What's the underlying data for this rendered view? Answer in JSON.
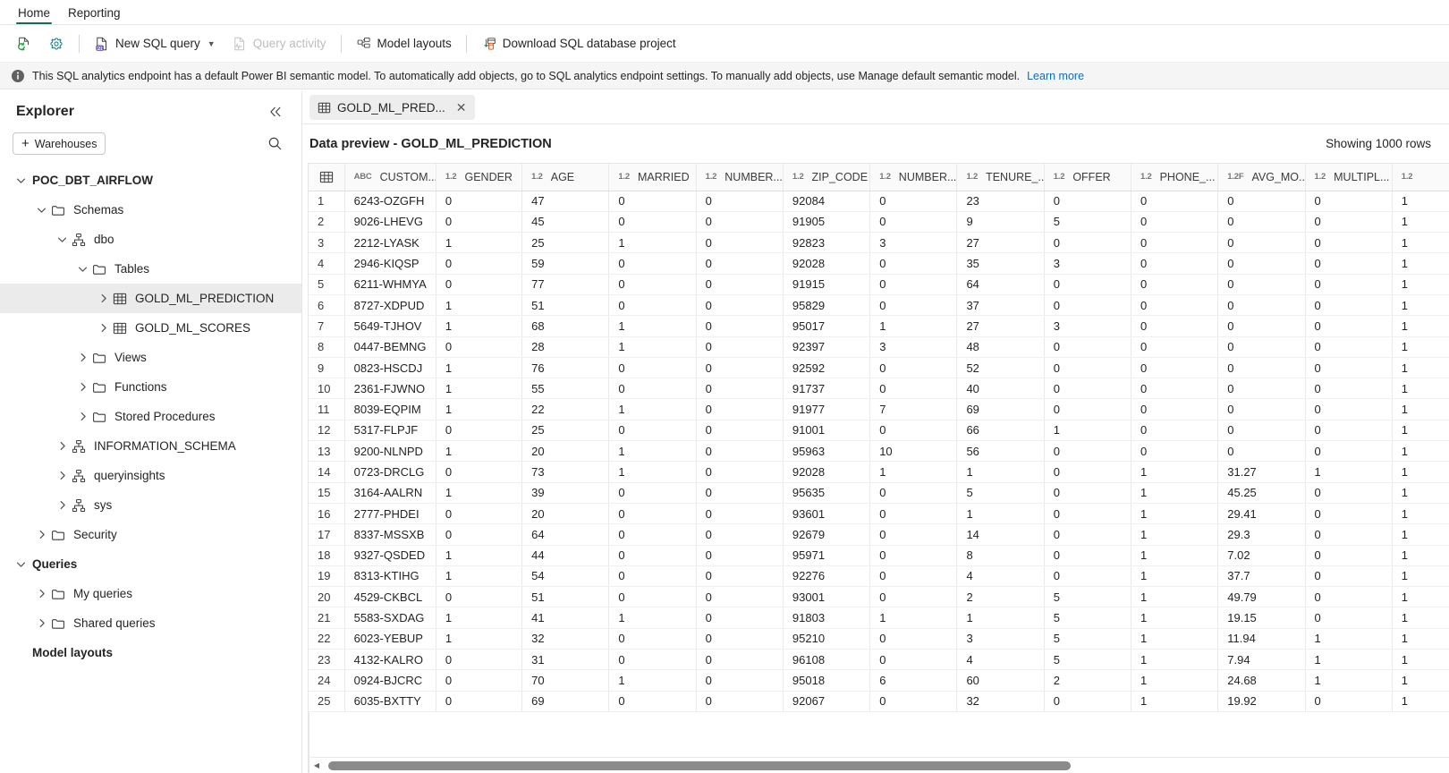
{
  "ribbon": {
    "tabs": [
      {
        "label": "Home",
        "active": true
      },
      {
        "label": "Reporting",
        "active": false
      }
    ]
  },
  "commandbar": {
    "refresh_tooltip": "Refresh",
    "settings_tooltip": "Settings",
    "new_sql_query": "New SQL query",
    "query_activity": "Query activity",
    "model_layouts": "Model layouts",
    "download_project": "Download SQL database project"
  },
  "infobar": {
    "message": "This SQL analytics endpoint has a default Power BI semantic model. To automatically add objects, go to SQL analytics endpoint settings. To manually add objects, use Manage default semantic model.",
    "link": "Learn more",
    "link_color": "#0f6cbd"
  },
  "explorer": {
    "title": "Explorer",
    "collapse_label": "«",
    "warehouses_button": "Warehouses",
    "add_glyph": "+",
    "tree": [
      {
        "label": "POC_DBT_AIRFLOW",
        "icon": "none",
        "expanded": true,
        "indent": 0,
        "bold": true,
        "selected": false
      },
      {
        "label": "Schemas",
        "icon": "folder",
        "expanded": true,
        "indent": 1,
        "bold": false,
        "selected": false
      },
      {
        "label": "dbo",
        "icon": "schema",
        "expanded": true,
        "indent": 2,
        "bold": false,
        "selected": false
      },
      {
        "label": "Tables",
        "icon": "folder",
        "expanded": true,
        "indent": 3,
        "bold": false,
        "selected": false
      },
      {
        "label": "GOLD_ML_PREDICTION",
        "icon": "table",
        "expanded": false,
        "indent": 4,
        "bold": false,
        "selected": true
      },
      {
        "label": "GOLD_ML_SCORES",
        "icon": "table",
        "expanded": false,
        "indent": 4,
        "bold": false,
        "selected": false
      },
      {
        "label": "Views",
        "icon": "folder",
        "expanded": false,
        "indent": 3,
        "bold": false,
        "selected": false
      },
      {
        "label": "Functions",
        "icon": "folder",
        "expanded": false,
        "indent": 3,
        "bold": false,
        "selected": false
      },
      {
        "label": "Stored Procedures",
        "icon": "folder",
        "expanded": false,
        "indent": 3,
        "bold": false,
        "selected": false
      },
      {
        "label": "INFORMATION_SCHEMA",
        "icon": "schema",
        "expanded": false,
        "indent": 2,
        "bold": false,
        "selected": false
      },
      {
        "label": "queryinsights",
        "icon": "schema",
        "expanded": false,
        "indent": 2,
        "bold": false,
        "selected": false
      },
      {
        "label": "sys",
        "icon": "schema",
        "expanded": false,
        "indent": 2,
        "bold": false,
        "selected": false
      },
      {
        "label": "Security",
        "icon": "folder",
        "expanded": false,
        "indent": 1,
        "bold": false,
        "selected": false
      },
      {
        "label": "Queries",
        "icon": "none",
        "expanded": true,
        "indent": 0,
        "bold": true,
        "selected": false
      },
      {
        "label": "My queries",
        "icon": "folder",
        "expanded": false,
        "indent": 1,
        "bold": false,
        "selected": false
      },
      {
        "label": "Shared queries",
        "icon": "folder",
        "expanded": false,
        "indent": 1,
        "bold": false,
        "selected": false
      },
      {
        "label": "Model layouts",
        "icon": "none",
        "expanded": null,
        "indent": 0,
        "bold": true,
        "selected": false
      }
    ]
  },
  "document_tab": {
    "label": "GOLD_ML_PRED...",
    "icon": "table-icon",
    "close_glyph": "✕"
  },
  "preview": {
    "title": "Data preview - GOLD_ML_PREDICTION",
    "rows_label": "Showing 1000 rows"
  },
  "grid": {
    "rownum_header_icon": "table-icon",
    "columns": [
      {
        "name": "CUSTOM...",
        "type": "ABC"
      },
      {
        "name": "GENDER",
        "type": "1.2"
      },
      {
        "name": "AGE",
        "type": "1.2"
      },
      {
        "name": "MARRIED",
        "type": "1.2"
      },
      {
        "name": "NUMBER...",
        "type": "1.2"
      },
      {
        "name": "ZIP_CODE",
        "type": "1.2"
      },
      {
        "name": "NUMBER...",
        "type": "1.2"
      },
      {
        "name": "TENURE_...",
        "type": "1.2"
      },
      {
        "name": "OFFER",
        "type": "1.2"
      },
      {
        "name": "PHONE_...",
        "type": "1.2"
      },
      {
        "name": "AVG_MO...",
        "type": "1.2F"
      },
      {
        "name": "MULTIPL...",
        "type": "1.2"
      },
      {
        "name": "",
        "type": "1.2"
      }
    ],
    "rows": [
      [
        "1",
        "6243-OZGFH",
        "0",
        "47",
        "0",
        "0",
        "92084",
        "0",
        "23",
        "0",
        "0",
        "0",
        "0",
        "1"
      ],
      [
        "2",
        "9026-LHEVG",
        "0",
        "45",
        "0",
        "0",
        "91905",
        "0",
        "9",
        "5",
        "0",
        "0",
        "0",
        "1"
      ],
      [
        "3",
        "2212-LYASK",
        "1",
        "25",
        "1",
        "0",
        "92823",
        "3",
        "27",
        "0",
        "0",
        "0",
        "0",
        "1"
      ],
      [
        "4",
        "2946-KIQSP",
        "0",
        "59",
        "0",
        "0",
        "92028",
        "0",
        "35",
        "3",
        "0",
        "0",
        "0",
        "1"
      ],
      [
        "5",
        "6211-WHMYA",
        "0",
        "77",
        "0",
        "0",
        "91915",
        "0",
        "64",
        "0",
        "0",
        "0",
        "0",
        "1"
      ],
      [
        "6",
        "8727-XDPUD",
        "1",
        "51",
        "0",
        "0",
        "95829",
        "0",
        "37",
        "0",
        "0",
        "0",
        "0",
        "1"
      ],
      [
        "7",
        "5649-TJHOV",
        "1",
        "68",
        "1",
        "0",
        "95017",
        "1",
        "27",
        "3",
        "0",
        "0",
        "0",
        "1"
      ],
      [
        "8",
        "0447-BEMNG",
        "0",
        "28",
        "1",
        "0",
        "92397",
        "3",
        "48",
        "0",
        "0",
        "0",
        "0",
        "1"
      ],
      [
        "9",
        "0823-HSCDJ",
        "1",
        "76",
        "0",
        "0",
        "92592",
        "0",
        "52",
        "0",
        "0",
        "0",
        "0",
        "1"
      ],
      [
        "10",
        "2361-FJWNO",
        "1",
        "55",
        "0",
        "0",
        "91737",
        "0",
        "40",
        "0",
        "0",
        "0",
        "0",
        "1"
      ],
      [
        "11",
        "8039-EQPIM",
        "1",
        "22",
        "1",
        "0",
        "91977",
        "7",
        "69",
        "0",
        "0",
        "0",
        "0",
        "1"
      ],
      [
        "12",
        "5317-FLPJF",
        "0",
        "25",
        "0",
        "0",
        "91001",
        "0",
        "66",
        "1",
        "0",
        "0",
        "0",
        "1"
      ],
      [
        "13",
        "9200-NLNPD",
        "1",
        "20",
        "1",
        "0",
        "95963",
        "10",
        "56",
        "0",
        "0",
        "0",
        "0",
        "1"
      ],
      [
        "14",
        "0723-DRCLG",
        "0",
        "73",
        "1",
        "0",
        "92028",
        "1",
        "1",
        "0",
        "1",
        "31.27",
        "1",
        "1"
      ],
      [
        "15",
        "3164-AALRN",
        "1",
        "39",
        "0",
        "0",
        "95635",
        "0",
        "5",
        "0",
        "1",
        "45.25",
        "0",
        "1"
      ],
      [
        "16",
        "2777-PHDEI",
        "0",
        "20",
        "0",
        "0",
        "93601",
        "0",
        "1",
        "0",
        "1",
        "29.41",
        "0",
        "1"
      ],
      [
        "17",
        "8337-MSSXB",
        "0",
        "64",
        "0",
        "0",
        "92679",
        "0",
        "14",
        "0",
        "1",
        "29.3",
        "0",
        "1"
      ],
      [
        "18",
        "9327-QSDED",
        "1",
        "44",
        "0",
        "0",
        "95971",
        "0",
        "8",
        "0",
        "1",
        "7.02",
        "0",
        "1"
      ],
      [
        "19",
        "8313-KTIHG",
        "1",
        "54",
        "0",
        "0",
        "92276",
        "0",
        "4",
        "0",
        "1",
        "37.7",
        "0",
        "1"
      ],
      [
        "20",
        "4529-CKBCL",
        "0",
        "51",
        "0",
        "0",
        "93001",
        "0",
        "2",
        "5",
        "1",
        "49.79",
        "0",
        "1"
      ],
      [
        "21",
        "5583-SXDAG",
        "1",
        "41",
        "1",
        "0",
        "91803",
        "1",
        "1",
        "5",
        "1",
        "19.15",
        "0",
        "1"
      ],
      [
        "22",
        "6023-YEBUP",
        "1",
        "32",
        "0",
        "0",
        "95210",
        "0",
        "3",
        "5",
        "1",
        "11.94",
        "1",
        "1"
      ],
      [
        "23",
        "4132-KALRO",
        "0",
        "31",
        "0",
        "0",
        "96108",
        "0",
        "4",
        "5",
        "1",
        "7.94",
        "1",
        "1"
      ],
      [
        "24",
        "0924-BJCRC",
        "0",
        "70",
        "1",
        "0",
        "95018",
        "6",
        "60",
        "2",
        "1",
        "24.68",
        "1",
        "1"
      ],
      [
        "25",
        "6035-BXTTY",
        "0",
        "69",
        "0",
        "0",
        "92067",
        "0",
        "32",
        "0",
        "1",
        "19.92",
        "0",
        "1"
      ]
    ]
  },
  "scrollbar": {
    "left_arrow": "◀",
    "thumb_position_pct": 0
  }
}
